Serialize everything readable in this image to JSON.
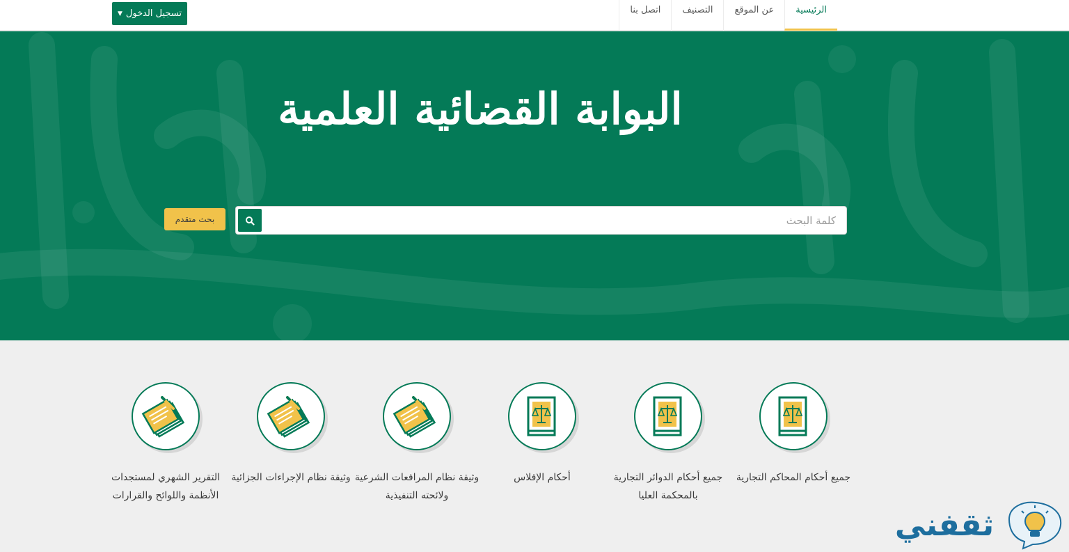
{
  "nav": {
    "items": [
      {
        "label": "الرئيسية",
        "active": true
      },
      {
        "label": "عن الموقع",
        "active": false
      },
      {
        "label": "التصنيف",
        "active": false
      },
      {
        "label": "اتصل بنا",
        "active": false
      }
    ],
    "login_label": "تسجيل الدخول"
  },
  "hero": {
    "title": "البوابة القضائية العلمية",
    "search_placeholder": "كلمة البحث",
    "advanced_label": "بحث متقدم"
  },
  "categories": [
    {
      "label": "جميع أحكام المحاكم التجارية",
      "icon": "law-book-icon"
    },
    {
      "label": "جميع أحكام الدوائر التجارية بالمحكمة العليا",
      "icon": "law-book-icon"
    },
    {
      "label": "أحكام الإفلاس",
      "icon": "law-book-icon"
    },
    {
      "label": "وثيقة نظام المرافعات الشرعية ولائحته التنفيذية",
      "icon": "documents-pen-icon"
    },
    {
      "label": "وثيقة نظام الإجراءات الجزائية",
      "icon": "documents-pen-icon"
    },
    {
      "label": "التقرير الشهري لمستجدات الأنظمة واللوائح والقرارات",
      "icon": "documents-pen-icon"
    }
  ],
  "watermark": {
    "text": "ثقفني"
  },
  "colors": {
    "primary": "#047a57",
    "accent": "#f1c24a",
    "background": "#efefef"
  }
}
